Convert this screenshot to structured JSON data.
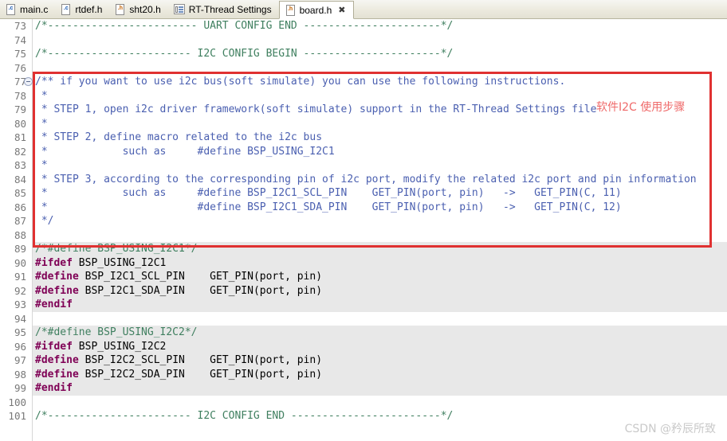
{
  "tabs": [
    {
      "label": "main.c",
      "icon": "c-file-icon",
      "kind": "c",
      "active": false,
      "closeable": false
    },
    {
      "label": "rtdef.h",
      "icon": "c-file-icon",
      "kind": "c",
      "active": false,
      "closeable": false
    },
    {
      "label": "sht20.h",
      "icon": "h-file-icon",
      "kind": "h",
      "active": false,
      "closeable": false
    },
    {
      "label": "RT-Thread Settings",
      "icon": "settings-file-icon",
      "kind": "settings",
      "active": false,
      "closeable": false
    },
    {
      "label": "board.h",
      "icon": "h-file-icon",
      "kind": "h",
      "active": true,
      "closeable": true,
      "close_glyph": "✖"
    }
  ],
  "editor": {
    "first_line": 73,
    "lines": [
      {
        "n": 73,
        "text": "/*------------------------ UART CONFIG END ----------------------*/",
        "style": "cmt",
        "hl": false
      },
      {
        "n": 74,
        "text": "",
        "style": "plain",
        "hl": false
      },
      {
        "n": 75,
        "text": "/*----------------------- I2C CONFIG BEGIN ----------------------*/",
        "style": "cmt",
        "hl": false
      },
      {
        "n": 76,
        "text": "",
        "style": "plain",
        "hl": false
      },
      {
        "n": 77,
        "text": "/** if you want to use i2c bus(soft simulate) you can use the following instructions.",
        "style": "blu",
        "hl": false,
        "fold": true
      },
      {
        "n": 78,
        "text": " *",
        "style": "blu",
        "hl": false
      },
      {
        "n": 79,
        "text": " * STEP 1, open i2c driver framework(soft simulate) support in the RT-Thread Settings file",
        "style": "blu",
        "hl": false
      },
      {
        "n": 80,
        "text": " *",
        "style": "blu",
        "hl": false
      },
      {
        "n": 81,
        "text": " * STEP 2, define macro related to the i2c bus",
        "style": "blu",
        "hl": false
      },
      {
        "n": 82,
        "text": " *            such as     #define BSP_USING_I2C1",
        "style": "blu",
        "hl": false
      },
      {
        "n": 83,
        "text": " *",
        "style": "blu",
        "hl": false
      },
      {
        "n": 84,
        "text": " * STEP 3, according to the corresponding pin of i2c port, modify the related i2c port and pin information",
        "style": "blu",
        "hl": false
      },
      {
        "n": 85,
        "text": " *            such as     #define BSP_I2C1_SCL_PIN    GET_PIN(port, pin)   ->   GET_PIN(C, 11)",
        "style": "blu",
        "hl": false
      },
      {
        "n": 86,
        "text": " *                        #define BSP_I2C1_SDA_PIN    GET_PIN(port, pin)   ->   GET_PIN(C, 12)",
        "style": "blu",
        "hl": false
      },
      {
        "n": 87,
        "text": " */",
        "style": "blu",
        "hl": false
      },
      {
        "n": 88,
        "text": "",
        "style": "plain",
        "hl": false
      },
      {
        "n": 89,
        "text": "/*#define BSP_USING_I2C1*/",
        "style": "cmt",
        "hl": true
      },
      {
        "n": 90,
        "text": "#ifdef BSP_USING_I2C1",
        "style": "pre-mixed",
        "pre": "#ifdef",
        "rest": " BSP_USING_I2C1",
        "hl": true
      },
      {
        "n": 91,
        "text": "#define BSP_I2C1_SCL_PIN    GET_PIN(port, pin)",
        "style": "pre-mixed",
        "pre": "#define",
        "rest": " BSP_I2C1_SCL_PIN    GET_PIN(port, pin)",
        "hl": true
      },
      {
        "n": 92,
        "text": "#define BSP_I2C1_SDA_PIN    GET_PIN(port, pin)",
        "style": "pre-mixed",
        "pre": "#define",
        "rest": " BSP_I2C1_SDA_PIN    GET_PIN(port, pin)",
        "hl": true
      },
      {
        "n": 93,
        "text": "#endif",
        "style": "pre-mixed",
        "pre": "#endif",
        "rest": "",
        "hl": true
      },
      {
        "n": 94,
        "text": "",
        "style": "plain",
        "hl": false
      },
      {
        "n": 95,
        "text": "/*#define BSP_USING_I2C2*/",
        "style": "cmt",
        "hl": true
      },
      {
        "n": 96,
        "text": "#ifdef BSP_USING_I2C2",
        "style": "pre-mixed",
        "pre": "#ifdef",
        "rest": " BSP_USING_I2C2",
        "hl": true
      },
      {
        "n": 97,
        "text": "#define BSP_I2C2_SCL_PIN    GET_PIN(port, pin)",
        "style": "pre-mixed",
        "pre": "#define",
        "rest": " BSP_I2C2_SCL_PIN    GET_PIN(port, pin)",
        "hl": true
      },
      {
        "n": 98,
        "text": "#define BSP_I2C2_SDA_PIN    GET_PIN(port, pin)",
        "style": "pre-mixed",
        "pre": "#define",
        "rest": " BSP_I2C2_SDA_PIN    GET_PIN(port, pin)",
        "hl": true
      },
      {
        "n": 99,
        "text": "#endif",
        "style": "pre-mixed",
        "pre": "#endif",
        "rest": "",
        "hl": true
      },
      {
        "n": 100,
        "text": "",
        "style": "plain",
        "hl": false
      },
      {
        "n": 101,
        "text": "/*----------------------- I2C CONFIG END ------------------------*/",
        "style": "cmt",
        "hl": false
      }
    ]
  },
  "annotation": {
    "text": "软件I2C 使用步骤",
    "box_color": "#e03131",
    "text_color": "#ef6a6a"
  },
  "watermark": {
    "text": "CSDN @矜辰所致",
    "color": "#c9c9c9"
  },
  "colors": {
    "comment_green": "#3f7f5f",
    "doc_comment_blue": "#4a5fb0",
    "preprocessor_magenta": "#7f0055",
    "highlight_bg": "#e8e8e8",
    "gutter_text": "#787878"
  }
}
